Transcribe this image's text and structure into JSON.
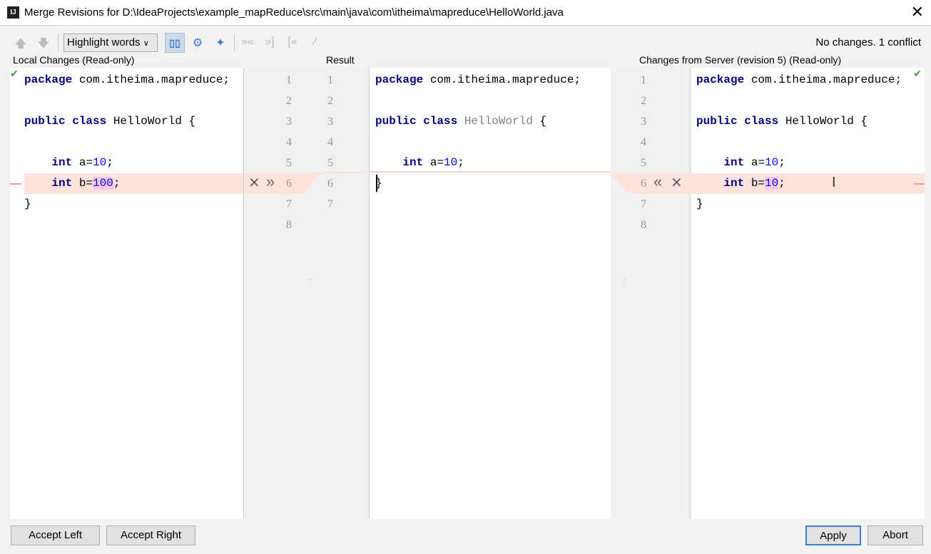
{
  "window": {
    "title": "Merge Revisions for D:\\IdeaProjects\\example_mapReduce\\src\\main\\java\\com\\itheima\\mapreduce\\HelloWorld.java",
    "icon": "IJ"
  },
  "toolbar": {
    "highlight_mode": "Highlight words",
    "status": "No changes. 1 conflict"
  },
  "panels": {
    "left": "Local Changes (Read-only)",
    "center": "Result",
    "right": "Changes from Server (revision 5) (Read-only)"
  },
  "left_lines": [
    "package com.itheima.mapreduce;",
    "",
    "public class HelloWorld {",
    "",
    "    int a=10;",
    "    int b=100;",
    "}"
  ],
  "result_lines": [
    "package com.itheima.mapreduce;",
    "",
    "public class HelloWorld {",
    "",
    "    int a=10;",
    "}",
    ""
  ],
  "right_lines": [
    "package com.itheima.mapreduce;",
    "",
    "public class HelloWorld {",
    "",
    "    int a=10;",
    "    int b=10;",
    "}"
  ],
  "left_line_numbers": [
    "1",
    "2",
    "3",
    "4",
    "5",
    "6",
    "7",
    "8"
  ],
  "result_line_numbers": [
    "1",
    "2",
    "3",
    "4",
    "5",
    "6",
    "7"
  ],
  "right_line_numbers": [
    "1",
    "2",
    "3",
    "4",
    "5",
    "6",
    "7",
    "8"
  ],
  "buttons": {
    "accept_left": "Accept Left",
    "accept_right": "Accept Right",
    "apply": "Apply",
    "abort": "Abort"
  },
  "colors": {
    "conflict": "#fde3dc",
    "keyword": "#000080",
    "number": "#0000ff"
  }
}
